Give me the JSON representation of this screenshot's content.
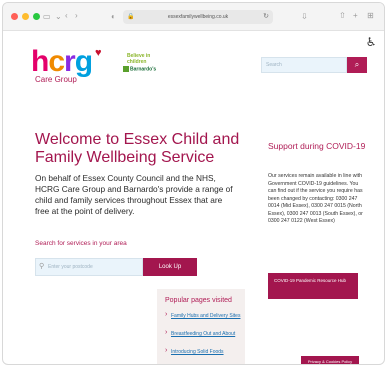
{
  "browser": {
    "url": "essexfamilywellbeing.co.uk"
  },
  "header": {
    "logo_main": "hcrg",
    "logo_sub": "Care Group",
    "partner_tagline": "Believe in children",
    "partner_name": "Barnardo's",
    "search_placeholder": "Search"
  },
  "hero": {
    "title": "Welcome to Essex Child and Family Wellbeing Service",
    "body": "On behalf of Essex County Council and the NHS, HCRG Care Group and Barnardo's provide a range of child and family services throughout Essex that are free at the point of delivery.",
    "search_label": "Search for services in your area",
    "postcode_placeholder": "Enter your postcode",
    "lookup_label": "Look Up"
  },
  "covid": {
    "title": "Support during COVID-19",
    "body": "Our services remain available in line with Government COVID-19 guidelines. You can find out if the service you require has been changed by contacting: 0300 247 0014 (Mid Essex), 0300 247 0015 (North Essex), 0300 247 0013 (South Essex), or 0300 247 0122 (West Essex)",
    "button_label": "COVID-19 Pandemic Resource Hub"
  },
  "popular": {
    "title": "Popular pages visited",
    "items": [
      "Family Hubs and Delivery Sites",
      "Breastfeeding Out and About",
      "Introducing Solid Foods"
    ]
  },
  "cookie": {
    "label": "Privacy & Cookies Policy"
  },
  "colors": {
    "brand": "#a3164e",
    "link": "#1a6fb0",
    "search_bg": "#eaf4fb"
  }
}
